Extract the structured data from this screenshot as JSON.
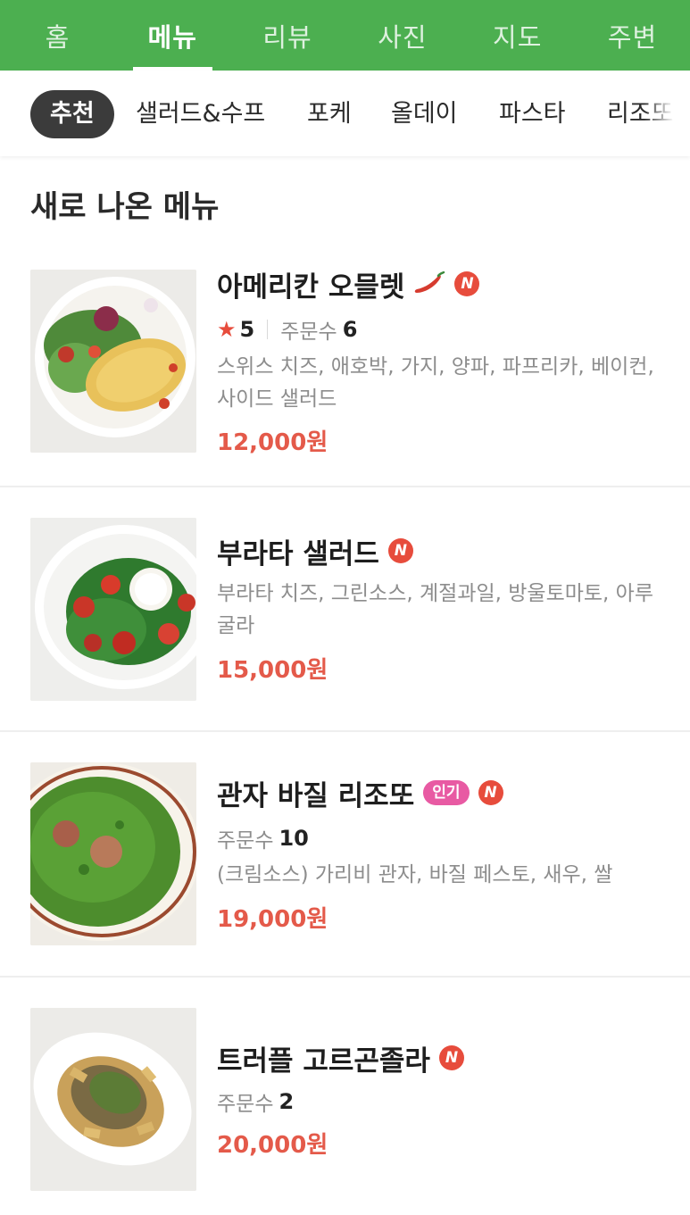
{
  "top_tabs": [
    {
      "label": "홈",
      "active": false
    },
    {
      "label": "메뉴",
      "active": true
    },
    {
      "label": "리뷰",
      "active": false
    },
    {
      "label": "사진",
      "active": false
    },
    {
      "label": "지도",
      "active": false
    },
    {
      "label": "주변",
      "active": false
    }
  ],
  "categories": [
    {
      "label": "추천",
      "active": true
    },
    {
      "label": "샐러드&수프",
      "active": false
    },
    {
      "label": "포케",
      "active": false
    },
    {
      "label": "올데이",
      "active": false
    },
    {
      "label": "파스타",
      "active": false
    },
    {
      "label": "리조또",
      "active": false
    }
  ],
  "section_title": "새로 나온 메뉴",
  "colors": {
    "brand_green": "#4caf50",
    "price_red": "#e45a4a",
    "new_badge": "#e74c3c",
    "popular_badge": "#e85aa3"
  },
  "menu_items": [
    {
      "name": "아메리칸 오믈렛",
      "spicy_icon": "chili-pepper-icon",
      "new_badge": "N",
      "rating": "5",
      "order_label": "주문수",
      "order_count": "6",
      "description": "스위스 치즈, 애호박, 가지, 양파, 파프리카, 베이컨, 사이드 샐러드",
      "price": "12,000원"
    },
    {
      "name": "부라타 샐러드",
      "new_badge": "N",
      "description": "부라타 치즈, 그린소스, 계절과일, 방울토마토, 아루굴라",
      "price": "15,000원"
    },
    {
      "name": "관자 바질 리조또",
      "popular_badge": "인기",
      "new_badge": "N",
      "order_label": "주문수",
      "order_count": "10",
      "description": "(크림소스) 가리비 관자, 바질 페스토, 새우, 쌀",
      "price": "19,000원"
    },
    {
      "name": "트러플 고르곤졸라",
      "new_badge": "N",
      "order_label": "주문수",
      "order_count": "2",
      "price": "20,000원"
    }
  ]
}
